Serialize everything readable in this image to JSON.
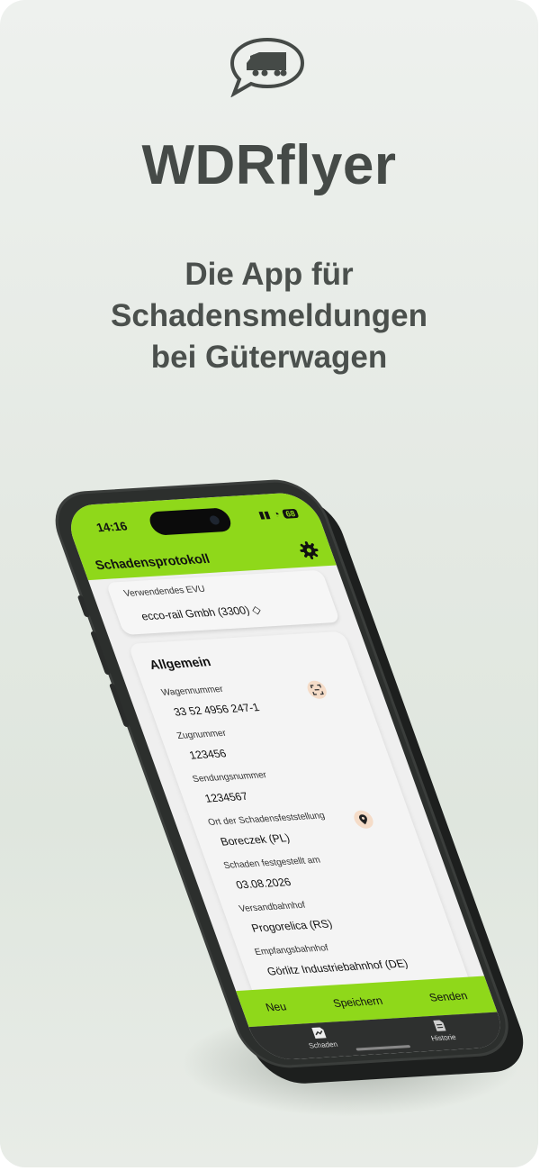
{
  "hero": {
    "app_name": "WDRflyer",
    "tagline_lines": [
      "Die App für",
      "Schadensmeldungen",
      "bei Güterwagen"
    ],
    "logo_icon": "chat-bubble-truck-icon"
  },
  "phone": {
    "status_bar": {
      "time": "14:16",
      "battery": "68"
    },
    "header": {
      "title": "Schadensprotokoll",
      "settings_icon": "gear-icon"
    },
    "evu": {
      "label": "Verwendendes EVU",
      "value": "ecco-rail Gmbh (3300) ◇"
    },
    "section": {
      "title": "Allgemein",
      "fields": [
        {
          "label": "Wagennummer",
          "value": "33 52 4956 247-1",
          "icon": "scan-icon"
        },
        {
          "label": "Zugnummer",
          "value": "123456"
        },
        {
          "label": "Sendungsnummer",
          "value": "1234567"
        },
        {
          "label": "Ort der Schadensfeststellung",
          "value": "Boreczek (PL)",
          "icon": "location-pin-icon"
        },
        {
          "label": "Schaden festgestellt am",
          "value": "03.08.2026"
        },
        {
          "label": "Versandbahnhof",
          "value": "Progorelica (RS)"
        },
        {
          "label": "Empfangsbahnhof",
          "value": "Görlitz Industriebahnhof (DE)"
        }
      ]
    },
    "actions": {
      "new": "Neu",
      "save": "Speichern",
      "send": "Senden"
    },
    "tabs": [
      {
        "label": "Schaden",
        "icon": "damage-report-icon"
      },
      {
        "label": "Historie",
        "icon": "history-icon"
      }
    ]
  },
  "colors": {
    "accent": "#8fd81a",
    "text_dark": "#454a47"
  }
}
